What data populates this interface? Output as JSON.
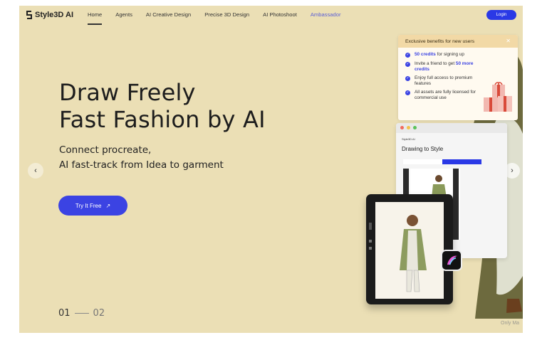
{
  "nav": {
    "logo": "Style3D AI",
    "links": [
      {
        "label": "Home",
        "active": true
      },
      {
        "label": "Agents"
      },
      {
        "label": "AI Creative Design"
      },
      {
        "label": "Precise 3D Design"
      },
      {
        "label": "AI Photoshoot"
      },
      {
        "label": "Ambassador",
        "accent": true
      }
    ],
    "login": "Login"
  },
  "hero": {
    "title_line1": "Draw Freely",
    "title_line2": "Fast Fashion by AI",
    "sub_line1": "Connect procreate,",
    "sub_line2": "AI fast-track from Idea to garment",
    "cta": "Try It Free"
  },
  "pager": {
    "current": "01",
    "next": "02"
  },
  "benefits": {
    "header": "Exclusive benefits for new users",
    "items": [
      {
        "highlight": "50 credits",
        "text": " for signing up"
      },
      {
        "prefix": "Invite a friend to get ",
        "highlight": "50 more credits"
      },
      {
        "text": "Enjoy full access to premium features"
      },
      {
        "text": "All assets are fully licensed for commercial use"
      }
    ]
  },
  "browser": {
    "logo": "Style3D AI",
    "title": "Drawing to Style"
  },
  "footer_text": "Only Ma",
  "colors": {
    "background": "#ebdfb5",
    "accent": "#3b43e3",
    "benefits_header": "#f2d9a6"
  }
}
